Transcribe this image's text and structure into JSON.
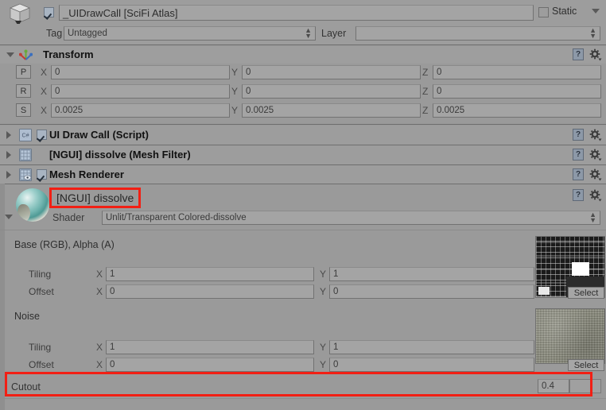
{
  "header": {
    "gameobject_icon": "cube-icon",
    "enabled": true,
    "name": "_UIDrawCall [SciFi Atlas]",
    "static_label": "Static",
    "static_checked": false,
    "tag_label": "Tag",
    "tag_value": "Untagged",
    "layer_label": "Layer",
    "layer_value": ""
  },
  "transform": {
    "title": "Transform",
    "icon": "transform-axis-icon",
    "help_icon": "?",
    "gear_icon": "gear-icon",
    "rows": [
      {
        "btn": "P",
        "x_label": "X",
        "x": "0",
        "y_label": "Y",
        "y": "0",
        "z_label": "Z",
        "z": "0"
      },
      {
        "btn": "R",
        "x_label": "X",
        "x": "0",
        "y_label": "Y",
        "y": "0",
        "z_label": "Z",
        "z": "0"
      },
      {
        "btn": "S",
        "x_label": "X",
        "x": "0.0025",
        "y_label": "Y",
        "y": "0.0025",
        "z_label": "Z",
        "z": "0.0025"
      }
    ]
  },
  "components": [
    {
      "name": "UI Draw Call (Script)",
      "icon": "csharp-script-icon",
      "has_checkbox": true,
      "enabled": true
    },
    {
      "name": "[NGUI] dissolve (Mesh Filter)",
      "icon": "mesh-filter-icon",
      "has_checkbox": false,
      "enabled": false
    },
    {
      "name": "Mesh Renderer",
      "icon": "mesh-renderer-icon",
      "has_checkbox": true,
      "enabled": true
    }
  ],
  "material": {
    "preview_icon": "material-sphere-preview",
    "name": "[NGUI] dissolve",
    "name_highlighted": true,
    "shader_label": "Shader",
    "shader_value": "Unlit/Transparent Colored-dissolve",
    "help_icon": "?",
    "gear_icon": "gear-icon",
    "properties": [
      {
        "title": "Base (RGB), Alpha (A)",
        "texture_icon": "sprite-atlas-texture",
        "select_label": "Select",
        "tiling_label": "Tiling",
        "tiling_x_label": "X",
        "tiling_x": "1",
        "tiling_y_label": "Y",
        "tiling_y": "1",
        "offset_label": "Offset",
        "offset_x_label": "X",
        "offset_x": "0",
        "offset_y_label": "Y",
        "offset_y": "0"
      },
      {
        "title": "Noise",
        "texture_icon": "noise-texture",
        "select_label": "Select",
        "tiling_label": "Tiling",
        "tiling_x_label": "X",
        "tiling_x": "1",
        "tiling_y_label": "Y",
        "tiling_y": "1",
        "offset_label": "Offset",
        "offset_x_label": "X",
        "offset_x": "0",
        "offset_y_label": "Y",
        "offset_y": "0"
      }
    ],
    "cutout_label": "Cutout",
    "cutout_value": "0.4",
    "cutout_highlighted": true
  },
  "colors": {
    "background": "#9a9a9a",
    "field": "#a4a4a4",
    "highlight": "#f21f14",
    "border": "#727272"
  }
}
